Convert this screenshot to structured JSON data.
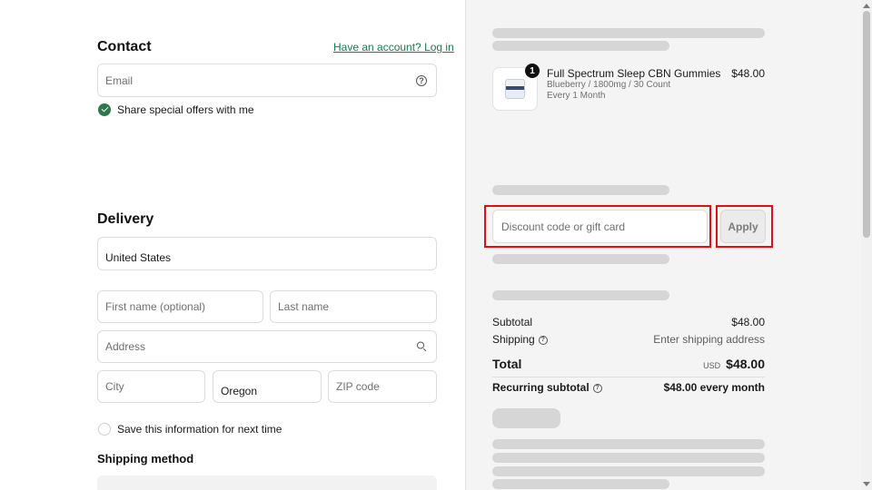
{
  "contact": {
    "title": "Contact",
    "login_link": "Have an account? Log in",
    "email_placeholder": "Email",
    "offers_label": "Share special offers with me"
  },
  "delivery": {
    "title": "Delivery",
    "country": "United States",
    "first_name_placeholder": "First name (optional)",
    "last_name_placeholder": "Last name",
    "address_placeholder": "Address",
    "city_placeholder": "City",
    "state": "Oregon",
    "zip_placeholder": "ZIP code",
    "save_info_label": "Save this information for next time"
  },
  "shipping_method": {
    "title": "Shipping method"
  },
  "order": {
    "product": {
      "quantity": "1",
      "name": "Full Spectrum Sleep CBN Gummies",
      "variant": "Blueberry / 1800mg / 30 Count",
      "frequency": "Every 1 Month",
      "price": "$48.00"
    },
    "discount_placeholder": "Discount code or gift card",
    "apply_label": "Apply",
    "subtotal_label": "Subtotal",
    "subtotal_value": "$48.00",
    "shipping_label": "Shipping",
    "shipping_value": "Enter shipping address",
    "total_label": "Total",
    "total_currency": "USD",
    "total_value": "$48.00",
    "recurring_label": "Recurring subtotal",
    "recurring_value": "$48.00 every month"
  },
  "colors": {
    "accent_green": "#2b7a4b",
    "link_green": "#197b4e",
    "highlight_red": "#e01010",
    "skeleton_gray": "#d6d6d6"
  }
}
